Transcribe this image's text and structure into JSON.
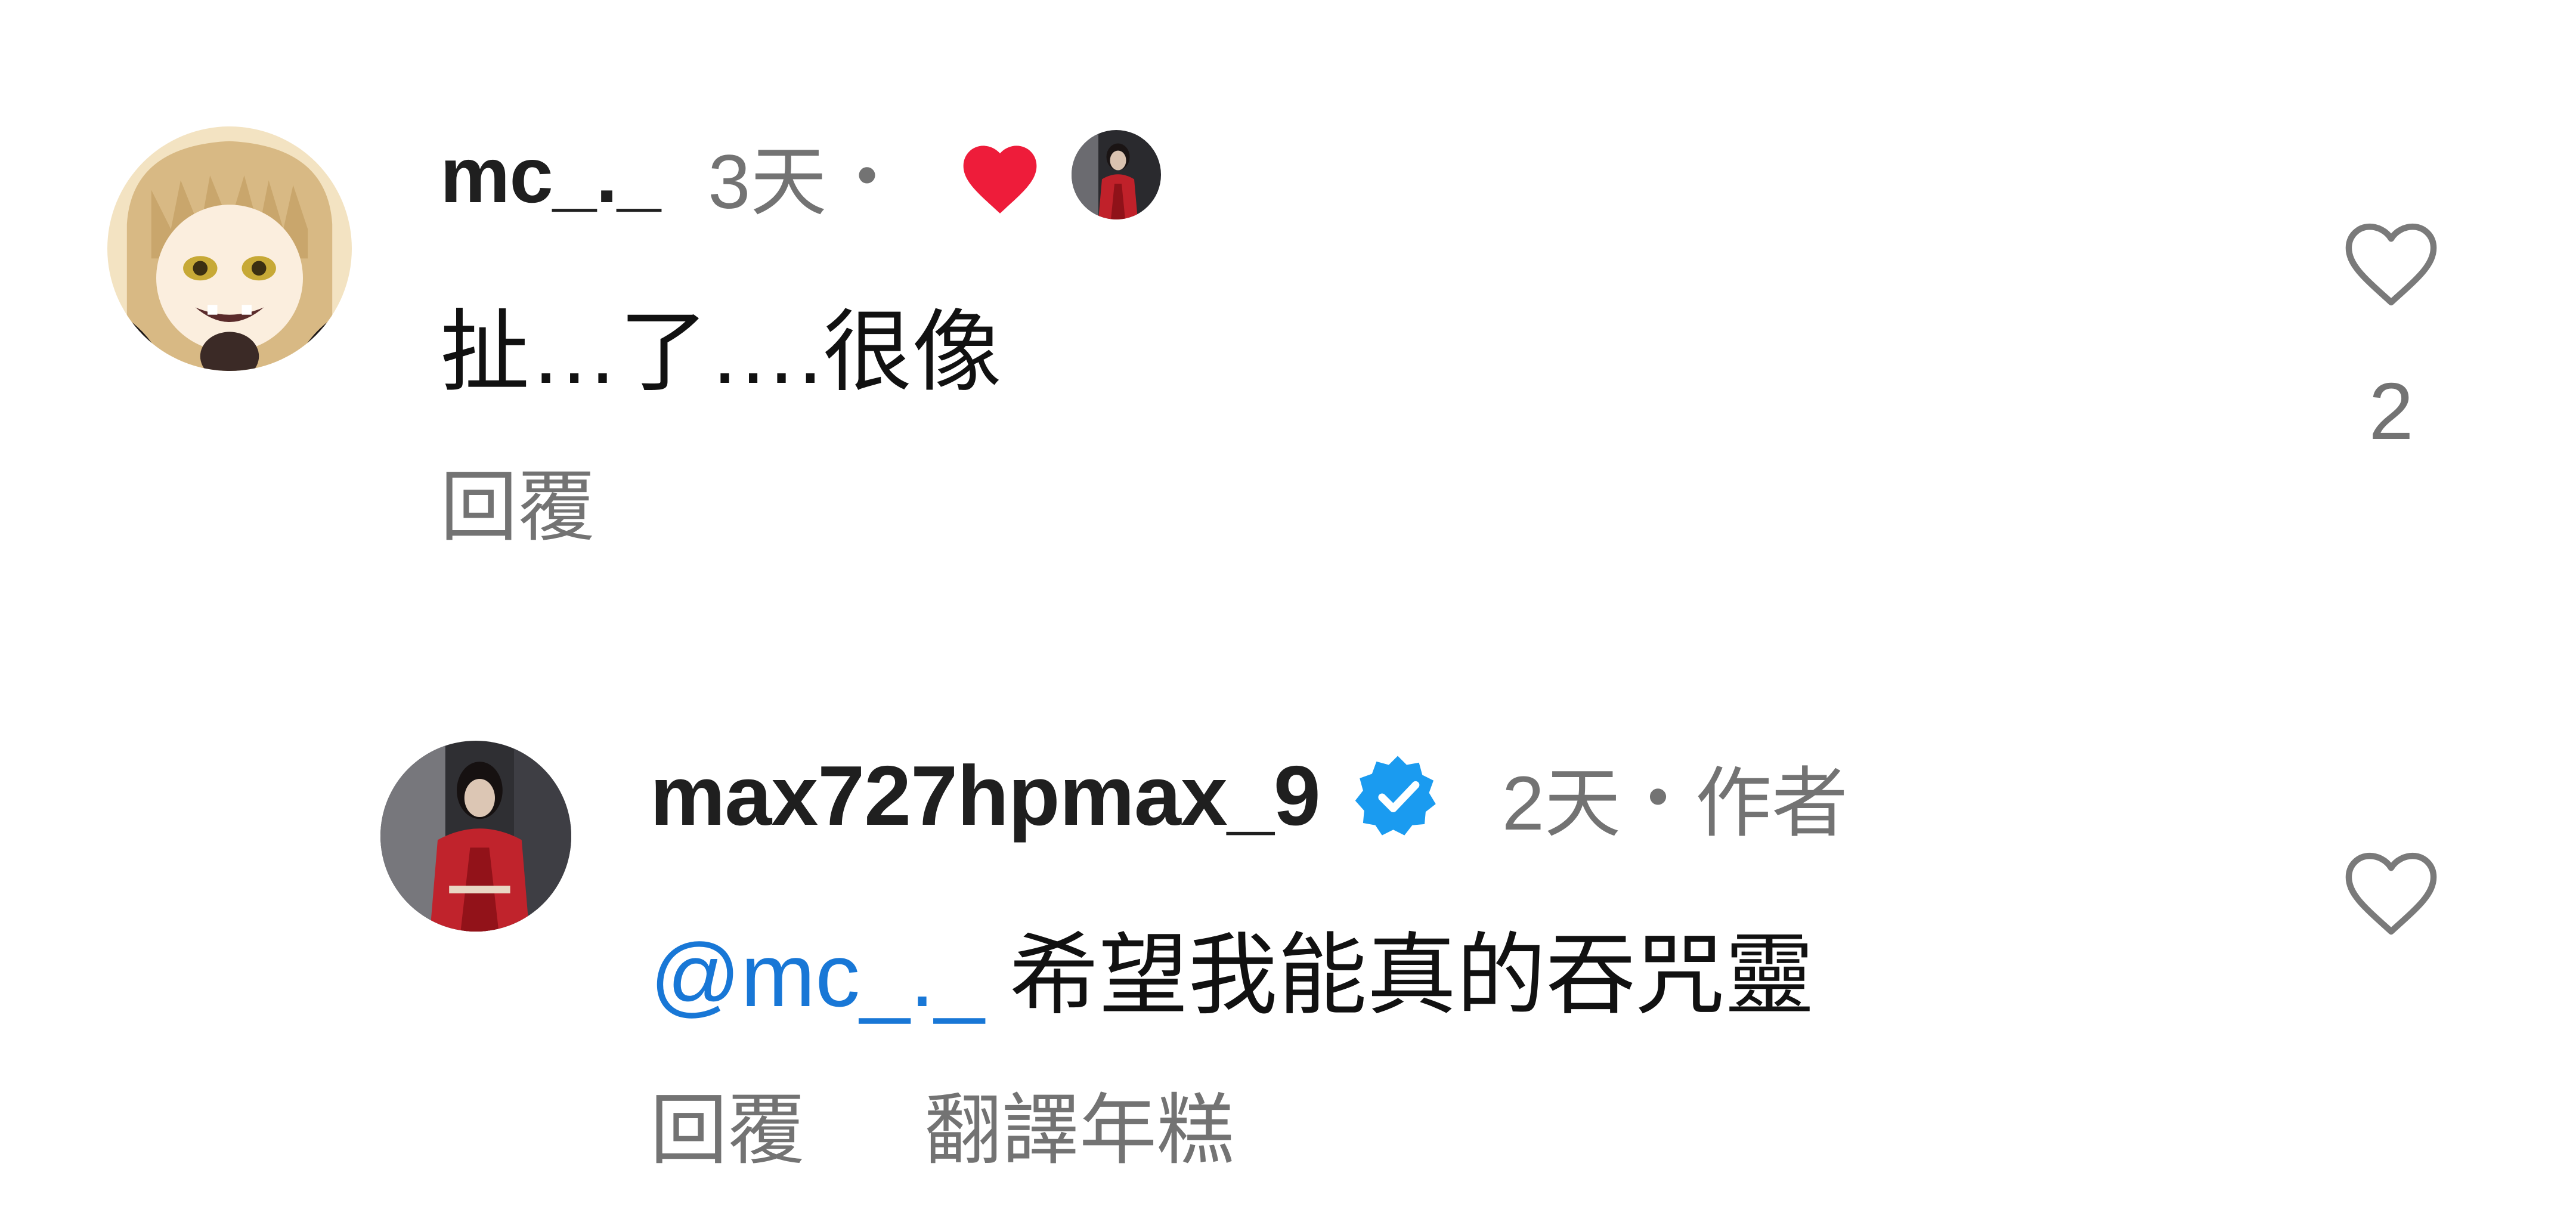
{
  "comments": [
    {
      "username": "mc_._",
      "time": "3天",
      "separator": "•",
      "creator_liked": true,
      "text": "扯…了….很像",
      "reply_label": "回覆",
      "like_count": "2"
    },
    {
      "username": "max727hpmax_9",
      "verified": true,
      "time": "2天",
      "separator": "•",
      "author_label": "作者",
      "mention": "@mc_._",
      "text": "希望我能真的吞咒靈",
      "reply_label": "回覆",
      "translate_label": "翻譯年糕"
    }
  ],
  "icons": {
    "like": "heart-outline-icon",
    "creator_like": "heart-filled-icon",
    "verified": "verified-badge-icon"
  },
  "colors": {
    "username": "#1f1f1f",
    "meta": "#737373",
    "mention": "#1877d6",
    "liked_heart": "#ee1c3a",
    "verified_badge": "#1a9bf0",
    "heart_outline": "#7a7a7a"
  }
}
